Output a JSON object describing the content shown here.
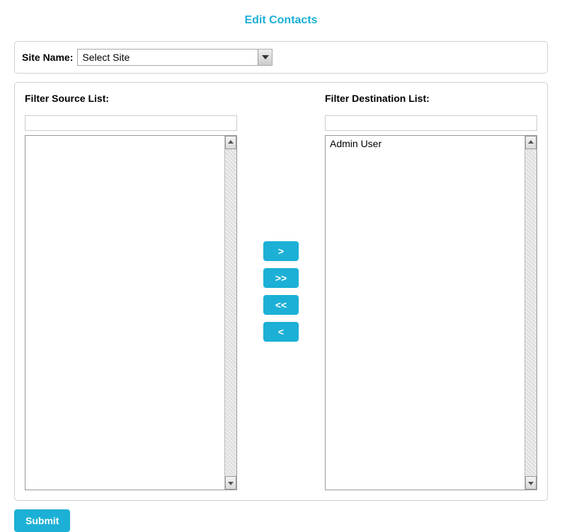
{
  "page": {
    "title": "Edit Contacts"
  },
  "site": {
    "label": "Site Name:",
    "selected": "Select Site",
    "options": [
      "Select Site"
    ]
  },
  "source": {
    "label": "Filter Source List:",
    "filter_value": "",
    "items": []
  },
  "destination": {
    "label": "Filter Destination List:",
    "filter_value": "",
    "items": [
      "Admin User"
    ]
  },
  "transfer": {
    "move_right": ">",
    "move_all_right": ">>",
    "move_all_left": "<<",
    "move_left": "<"
  },
  "actions": {
    "submit": "Submit"
  }
}
